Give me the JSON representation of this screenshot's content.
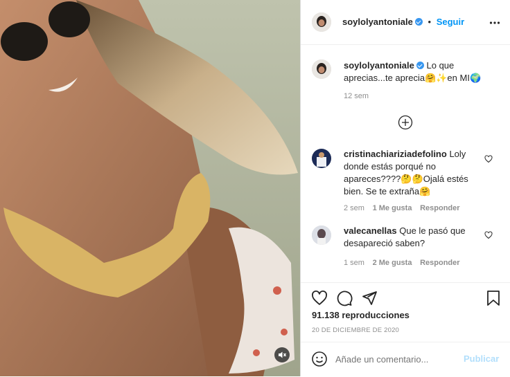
{
  "post": {
    "username": "soylolyantoniale",
    "follow_label": "Seguir",
    "more_icon": "more-horizontal-icon",
    "caption": "Lo que aprecias...te aprecia🤗✨en MI🌍",
    "caption_time": "12 sem",
    "load_more_icon": "plus-circle-icon",
    "views": "91.138 reproducciones",
    "date": "20 DE DICIEMBRE DE 2020",
    "sound_icon": "sound-off-icon"
  },
  "comments": [
    {
      "username": "cristinachiariziadefolino",
      "text": "Loly donde estás porqué no apareces????🤔🤔Ojalá estés bien. Se te extraña🤗",
      "time": "2 sem",
      "likes": "1 Me gusta",
      "reply": "Responder"
    },
    {
      "username": "valecanellas",
      "text": "Que le pasó que desapareció saben?",
      "time": "1 sem",
      "likes": "2 Me gusta",
      "reply": "Responder"
    }
  ],
  "composer": {
    "placeholder": "Añade un comentario...",
    "publish_label": "Publicar",
    "emoji_icon": "smiley-icon"
  },
  "icons": {
    "like": "heart-icon",
    "comment": "comment-icon",
    "share": "send-icon",
    "save": "bookmark-icon"
  },
  "colors": {
    "link_blue": "#0095f6",
    "verified_blue": "#3897f0",
    "muted": "#8e8e8e",
    "publish_disabled": "#b2dffc"
  }
}
